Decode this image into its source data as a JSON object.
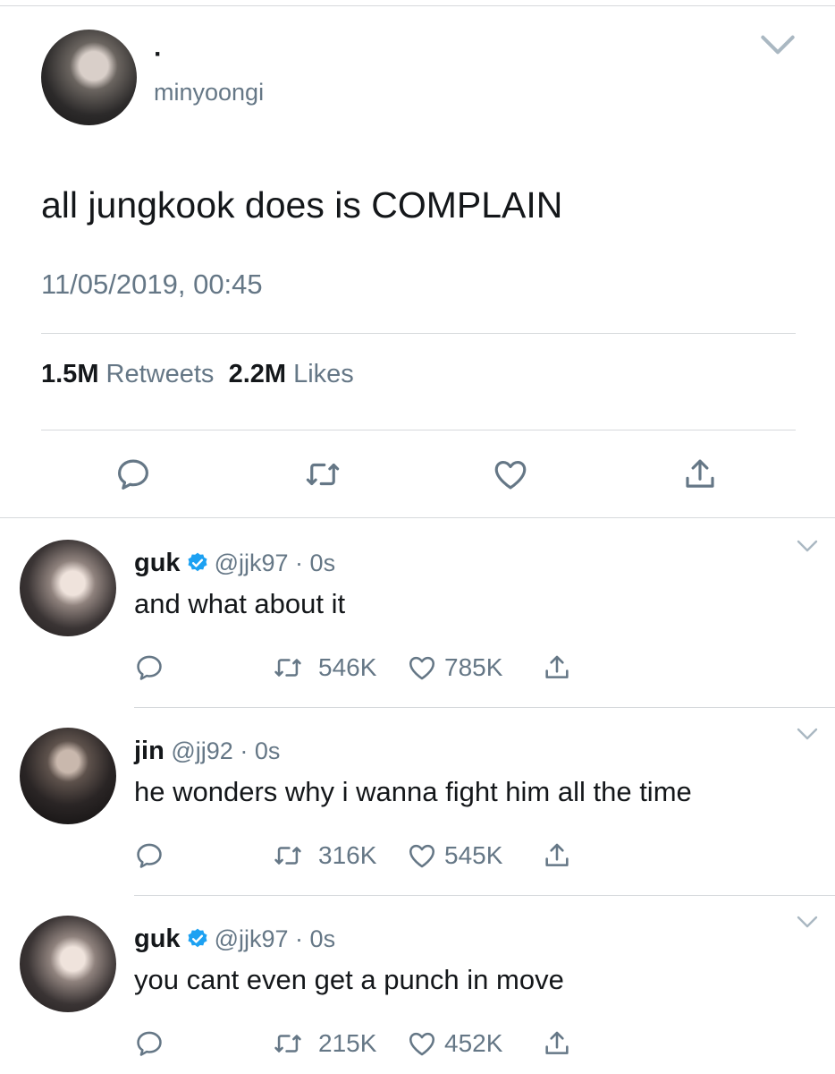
{
  "main_tweet": {
    "display_name": "·",
    "handle": "minyoongi",
    "text": "all jungkook does is COMPLAIN",
    "timestamp": "11/05/2019, 00:45",
    "retweets_count": "1.5M",
    "retweets_label": "Retweets",
    "likes_count": "2.2M",
    "likes_label": "Likes",
    "icons": [
      "chevron-down-icon",
      "reply-icon",
      "retweet-icon",
      "like-icon",
      "share-icon"
    ]
  },
  "replies": [
    {
      "name": "guk",
      "verified": true,
      "handle": "@jjk97",
      "sep": "·",
      "time": "0s",
      "text": "and what about it",
      "retweets": "546K",
      "likes": "785K"
    },
    {
      "name": "jin",
      "verified": false,
      "handle": "@jj92",
      "sep": "·",
      "time": "0s",
      "text": "he wonders why i wanna fight him all the time",
      "retweets": "316K",
      "likes": "545K"
    },
    {
      "name": "guk",
      "verified": true,
      "handle": "@jjk97",
      "sep": "·",
      "time": "0s",
      "text": "you cant even get a punch in move",
      "retweets": "215K",
      "likes": "452K"
    }
  ],
  "colors": {
    "text": "#14171a",
    "secondary": "#657786",
    "divider": "#d6d9dc",
    "verified_blue": "#1da1f2",
    "background": "#ffffff"
  }
}
